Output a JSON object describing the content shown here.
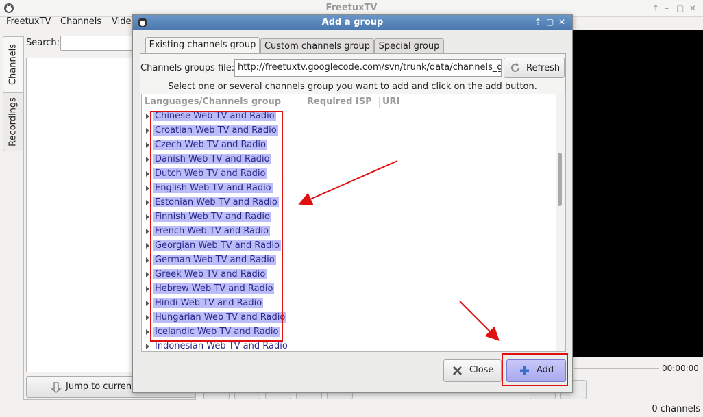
{
  "main_window": {
    "title": "FreetuxTV",
    "menu": [
      "FreetuxTV",
      "Channels",
      "Video"
    ],
    "side_tabs": [
      "Channels",
      "Recordings"
    ],
    "search_label": "Search:",
    "jump_button": "Jump to current",
    "time": "00:00:00",
    "status": "0 channels"
  },
  "dialog": {
    "title": "Add a group",
    "tabs": [
      "Existing channels group",
      "Custom channels group",
      "Special group"
    ],
    "file_label": "Channels groups file:",
    "file_value": "http://freetuxtv.googlecode.com/svn/trunk/data/channels_gr",
    "refresh_button": "Refresh",
    "instruction": "Select one or several channels group you want to add and click on the add button.",
    "columns": [
      "Languages/Channels group",
      "Required ISP",
      "URI"
    ],
    "groups": [
      "Chinese Web TV and Radio",
      "Croatian Web TV and Radio",
      "Czech Web TV and Radio",
      "Danish Web TV and Radio",
      "Dutch Web TV and Radio",
      "English Web TV and Radio",
      "Estonian Web TV and Radio",
      "Finnish Web TV and Radio",
      "French Web TV and Radio",
      "Georgian Web TV and Radio",
      "German Web TV and Radio",
      "Greek Web TV and Radio",
      "Hebrew Web TV and Radio",
      "Hindi Web TV and Radio",
      "Hungarian Web TV and Radio",
      "Icelandic Web TV and Radio",
      "Indonesian Web TV and Radio"
    ],
    "selected_count": 16,
    "close_button": "Close",
    "add_button": "Add"
  },
  "colors": {
    "selection": "#bcbcf8",
    "annotation": "#e01010",
    "titlebar": "#5482ba"
  },
  "icons": [
    "freetuxtv-logo-icon",
    "refresh-icon",
    "close-x-icon",
    "plus-icon",
    "expander-arrow-icon"
  ]
}
